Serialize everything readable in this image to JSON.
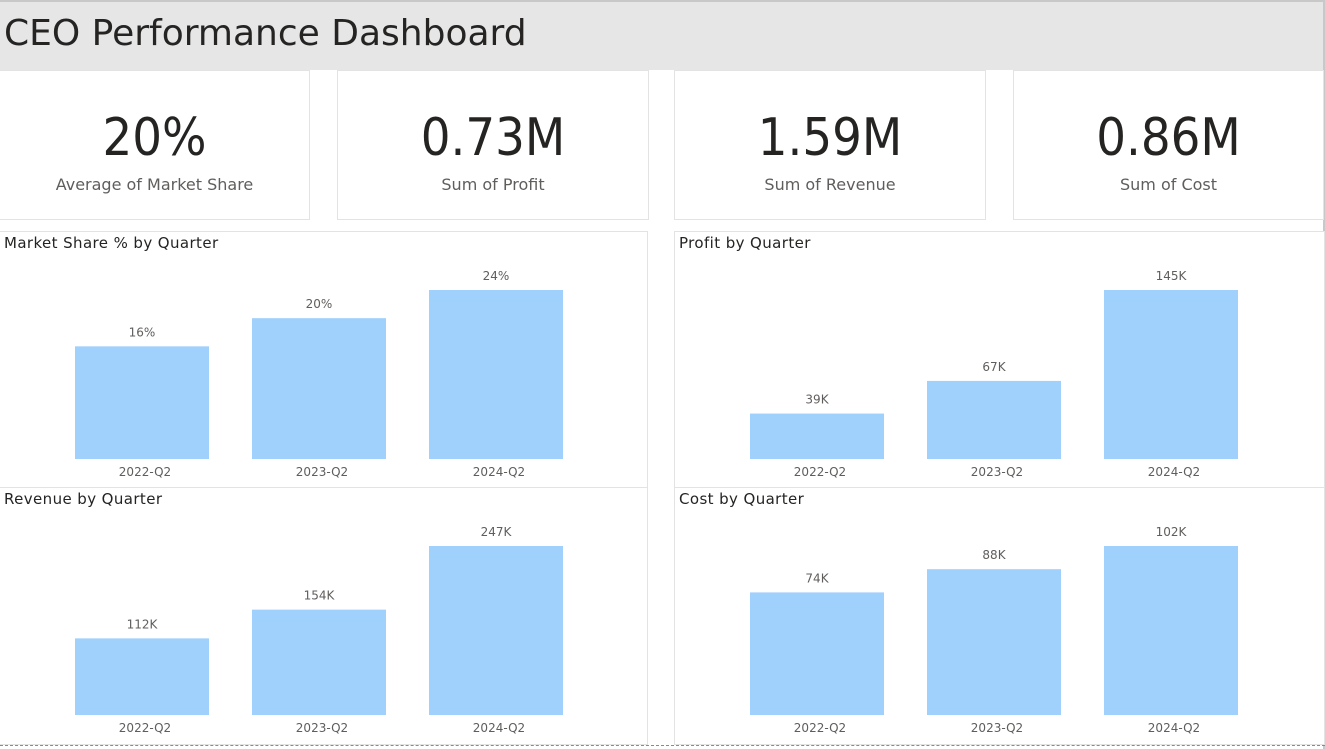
{
  "title": "CEO Performance Dashboard",
  "colors": {
    "bar": "#a0d0fc",
    "header_bg": "#e6e6e6",
    "text": "#252423",
    "muted_text": "#605e5c"
  },
  "cards": [
    {
      "value": "20%",
      "label": "Average of Market Share"
    },
    {
      "value": "0.73M",
      "label": "Sum of Profit"
    },
    {
      "value": "1.59M",
      "label": "Sum of Revenue"
    },
    {
      "value": "0.86M",
      "label": "Sum of Cost"
    }
  ],
  "chart_data": [
    {
      "type": "bar",
      "title": "Market Share % by Quarter",
      "categories": [
        "2022-Q2",
        "2023-Q2",
        "2024-Q2"
      ],
      "values": [
        16,
        20,
        24
      ],
      "labels": [
        "16%",
        "20%",
        "24%"
      ],
      "ylim": [
        0,
        24
      ],
      "xlabel": "",
      "ylabel": ""
    },
    {
      "type": "bar",
      "title": "Profit by Quarter",
      "categories": [
        "2022-Q2",
        "2023-Q2",
        "2024-Q2"
      ],
      "values": [
        39000,
        67000,
        145000
      ],
      "labels": [
        "39K",
        "67K",
        "145K"
      ],
      "ylim": [
        0,
        145000
      ],
      "xlabel": "",
      "ylabel": ""
    },
    {
      "type": "bar",
      "title": "Revenue by Quarter",
      "categories": [
        "2022-Q2",
        "2023-Q2",
        "2024-Q2"
      ],
      "values": [
        112000,
        154000,
        247000
      ],
      "labels": [
        "112K",
        "154K",
        "247K"
      ],
      "ylim": [
        0,
        247000
      ],
      "xlabel": "",
      "ylabel": ""
    },
    {
      "type": "bar",
      "title": "Cost by Quarter",
      "categories": [
        "2022-Q2",
        "2023-Q2",
        "2024-Q2"
      ],
      "values": [
        74000,
        88000,
        102000
      ],
      "labels": [
        "74K",
        "88K",
        "102K"
      ],
      "ylim": [
        0,
        102000
      ],
      "xlabel": "",
      "ylabel": ""
    }
  ]
}
